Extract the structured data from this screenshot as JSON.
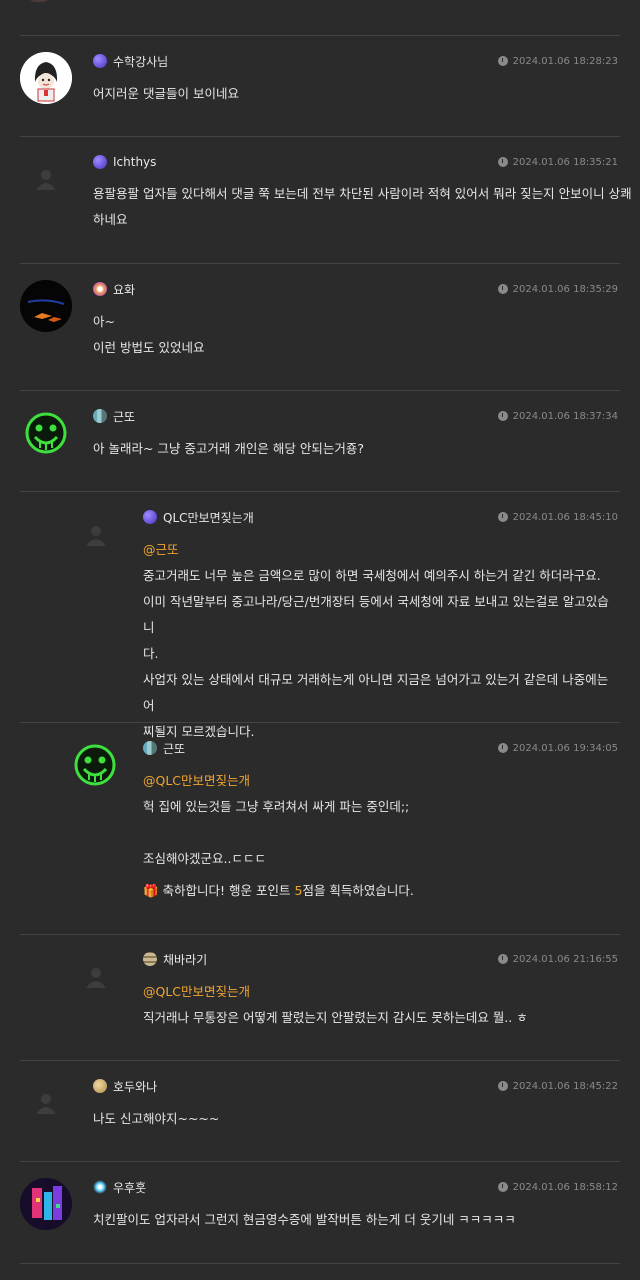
{
  "comments": [
    {
      "nick": "수학강사님",
      "time": "2024.01.06 18:28:23",
      "lines": [
        "어지러운 댓글들이 보이네요"
      ]
    },
    {
      "nick": "Ichthys",
      "time": "2024.01.06 18:35:21",
      "lines": [
        "용팔용팔 업자들 있다해서 댓글 쭉 보는데 전부 차단된 사람이라 적혀 있어서 뭐라 짖는지 안보이니 상쾌",
        "하네요"
      ]
    },
    {
      "nick": "요화",
      "time": "2024.01.06 18:35:29",
      "lines": [
        "아~",
        "이런 방법도 있었네요"
      ]
    },
    {
      "nick": "근또",
      "time": "2024.01.06 18:37:34",
      "lines": [
        "아 놀래라~ 그냥 중고거래 개인은 해당 안되는거죵?"
      ]
    },
    {
      "nick": "QLC만보면짖는개",
      "time": "2024.01.06 18:45:10",
      "mention": "@근또",
      "lines": [
        "중고거래도 너무 높은 금액으로 많이 하면 국세청에서 예의주시 하는거 같긴 하더라구요.",
        "이미 작년말부터 중고나라/당근/번개장터 등에서 국세청에 자료 보내고 있는걸로 알고있습니",
        "다.",
        "사업자 있는 상태에서 대규모 거래하는게 아니면 지금은 넘어가고 있는거 같은데 나중에는 어",
        "찌될지 모르겠습니다."
      ]
    },
    {
      "nick": "근또",
      "time": "2024.01.06 19:34:05",
      "mention": "@QLC만보면짖는개",
      "lines": [
        "헉 집에 있는것들 그냥 후려쳐서 싸게 파는 중인데;;",
        "",
        "조심해야겠군요..ㄷㄷㄷ"
      ],
      "reward": {
        "prefix": "🎁 축하합니다! 행운 포인트 ",
        "points": "5",
        "suffix": "점을 획득하였습니다."
      }
    },
    {
      "nick": "채바라기",
      "time": "2024.01.06 21:16:55",
      "mention": "@QLC만보면짖는개",
      "lines": [
        "직거래나 무통장은 어떻게 팔렸는지 안팔렸는지 감시도 못하는데요 뭘.. ㅎ"
      ]
    },
    {
      "nick": "호두와나",
      "time": "2024.01.06 18:45:22",
      "lines": [
        "나도 신고해야지~~~~"
      ]
    },
    {
      "nick": "우후훗",
      "time": "2024.01.06 18:58:12",
      "lines": [
        "치킨팔이도 업자라서 그런지 현금영수증에 발작버튼 하는게 더 웃기네 ㅋㅋㅋㅋㅋ"
      ]
    }
  ]
}
